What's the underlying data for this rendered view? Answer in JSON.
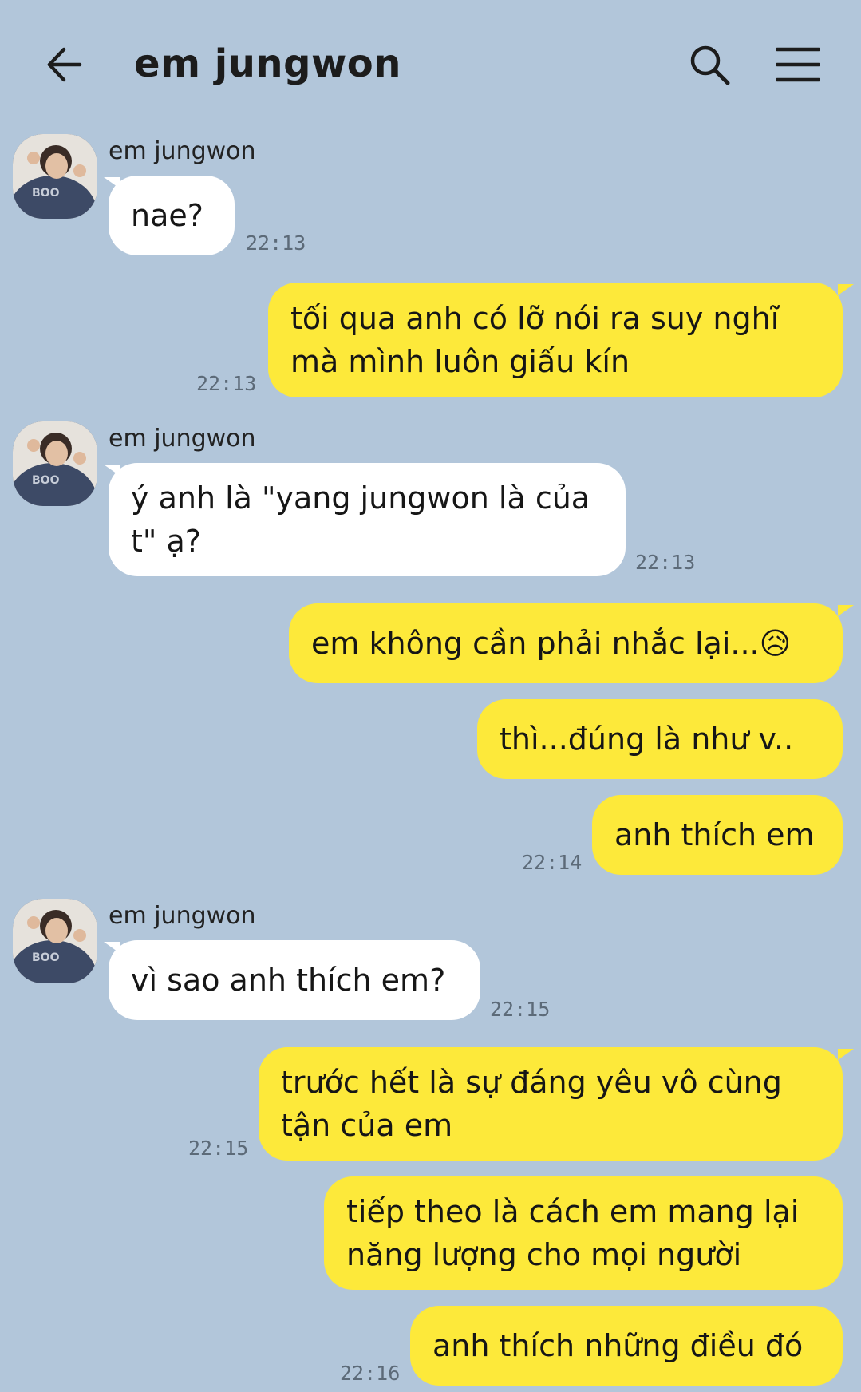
{
  "header": {
    "title": "em jungwon",
    "back_icon": "arrow-left-icon",
    "search_icon": "search-icon",
    "menu_icon": "hamburger-menu-icon"
  },
  "contact": {
    "name": "em jungwon"
  },
  "messages": [
    {
      "from": "them",
      "text": "nae?",
      "time": "22:13"
    },
    {
      "from": "me",
      "text": "tối qua anh có lỡ nói ra suy nghĩ mà mình luôn giấu kín",
      "time": "22:13"
    },
    {
      "from": "them",
      "text": "ý anh là \"yang jungwon là của t\" ạ?",
      "time": "22:13"
    },
    {
      "from": "me",
      "text": "em không cần phải nhắc lại...😥",
      "time": ""
    },
    {
      "from": "me",
      "text": "thì...đúng là như v..",
      "time": ""
    },
    {
      "from": "me",
      "text": "anh thích em",
      "time": "22:14"
    },
    {
      "from": "them",
      "text": "vì sao anh thích em?",
      "time": "22:15"
    },
    {
      "from": "me",
      "text": "trước hết là sự đáng yêu vô cùng tận của em",
      "time": "22:15"
    },
    {
      "from": "me",
      "text": "tiếp theo là cách em mang lại năng lượng cho mọi người",
      "time": ""
    },
    {
      "from": "me",
      "text": "anh thích những điều đó",
      "time": "22:16"
    }
  ],
  "colors": {
    "background": "#b2c6da",
    "incoming_bubble": "#ffffff",
    "outgoing_bubble": "#fde93a"
  }
}
